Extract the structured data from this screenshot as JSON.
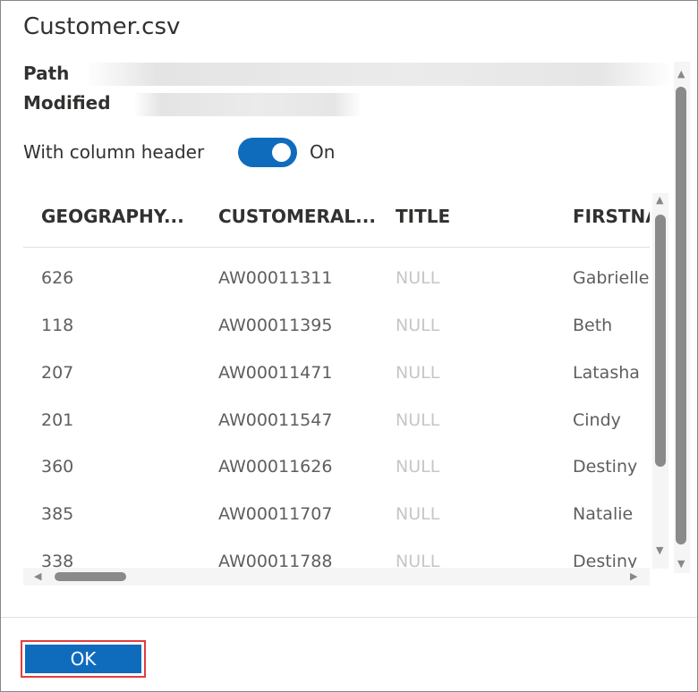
{
  "dialog": {
    "title": "Customer.csv",
    "path_label": "Path",
    "modified_label": "Modified",
    "toggle_label": "With column header",
    "toggle_state": "On",
    "ok_label": "OK"
  },
  "grid": {
    "columns": [
      "GEOGRAPHY...",
      "CUSTOMERAL...",
      "TITLE",
      "FIRSTNA"
    ],
    "rows": [
      [
        "626",
        "AW00011311",
        "NULL",
        "Gabrielle"
      ],
      [
        "118",
        "AW00011395",
        "NULL",
        "Beth"
      ],
      [
        "207",
        "AW00011471",
        "NULL",
        "Latasha"
      ],
      [
        "201",
        "AW00011547",
        "NULL",
        "Cindy"
      ],
      [
        "360",
        "AW00011626",
        "NULL",
        "Destiny"
      ],
      [
        "385",
        "AW00011707",
        "NULL",
        "Natalie"
      ],
      [
        "338",
        "AW00011788",
        "NULL",
        "Destiny"
      ]
    ]
  },
  "colors": {
    "accent": "#0f6cbd",
    "highlight_outline": "#e23d3d",
    "null_text": "#c8c6c4"
  },
  "icons": {
    "scroll_up": "triangle-up-icon",
    "scroll_down": "triangle-down-icon",
    "scroll_left": "triangle-left-icon",
    "scroll_right": "triangle-right-icon"
  }
}
